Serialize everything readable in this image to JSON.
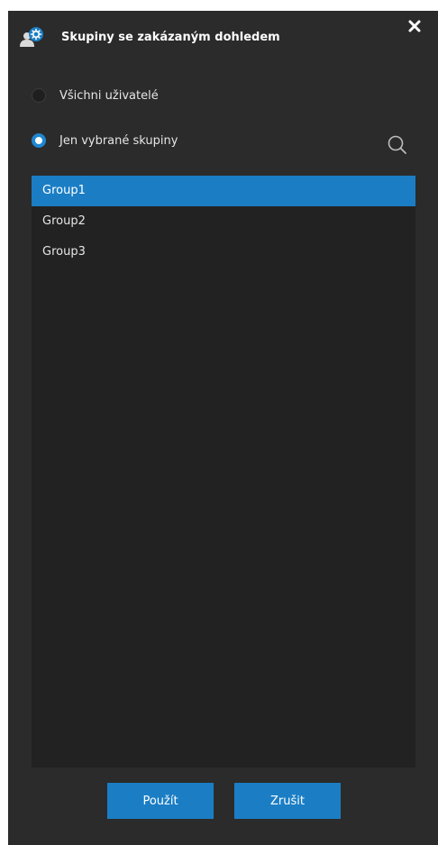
{
  "dialog": {
    "title": "Skupiny se zakázaným dohledem",
    "icon": "user-group-settings-icon",
    "close_icon": "close-icon"
  },
  "options": [
    {
      "label": "Všichni uživatelé",
      "selected": false
    },
    {
      "label": "Jen vybrané skupiny",
      "selected": true
    }
  ],
  "search": {
    "icon": "search-icon"
  },
  "groups": {
    "items": [
      {
        "label": "Group1",
        "selected": true
      },
      {
        "label": "Group2",
        "selected": false
      },
      {
        "label": "Group3",
        "selected": false
      }
    ]
  },
  "buttons": {
    "apply_label": "Použít",
    "cancel_label": "Zrušit"
  },
  "colors": {
    "background": "#2b2b2b",
    "list_background": "#222222",
    "accent": "#1b7ec5",
    "text": "#e6e6e6"
  }
}
